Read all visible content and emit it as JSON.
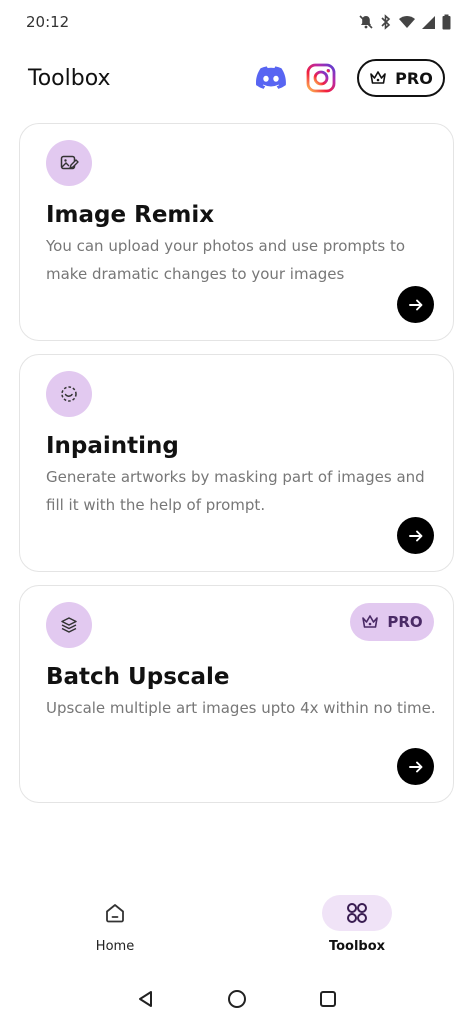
{
  "status_bar": {
    "time": "20:12"
  },
  "header": {
    "title": "Toolbox",
    "pro_label": "PRO"
  },
  "cards": [
    {
      "title": "Image Remix",
      "description": "You can upload your photos and use prompts to make dramatic changes to your images",
      "icon": "image-edit-icon"
    },
    {
      "title": "Inpainting",
      "description": "Generate artworks by masking part of images and fill it with the help of prompt.",
      "icon": "mask-icon"
    },
    {
      "title": "Batch Upscale",
      "description": "Upscale multiple art images upto 4x within no time.",
      "icon": "layers-icon",
      "badge": "PRO"
    }
  ],
  "bottom_nav": [
    {
      "label": "Home",
      "icon": "home-icon",
      "active": false
    },
    {
      "label": "Toolbox",
      "icon": "toolbox-icon",
      "active": true
    }
  ],
  "colors": {
    "accent_soft": "#e2c9f0",
    "accent_dark": "#4a2a66",
    "discord": "#5865F2"
  }
}
